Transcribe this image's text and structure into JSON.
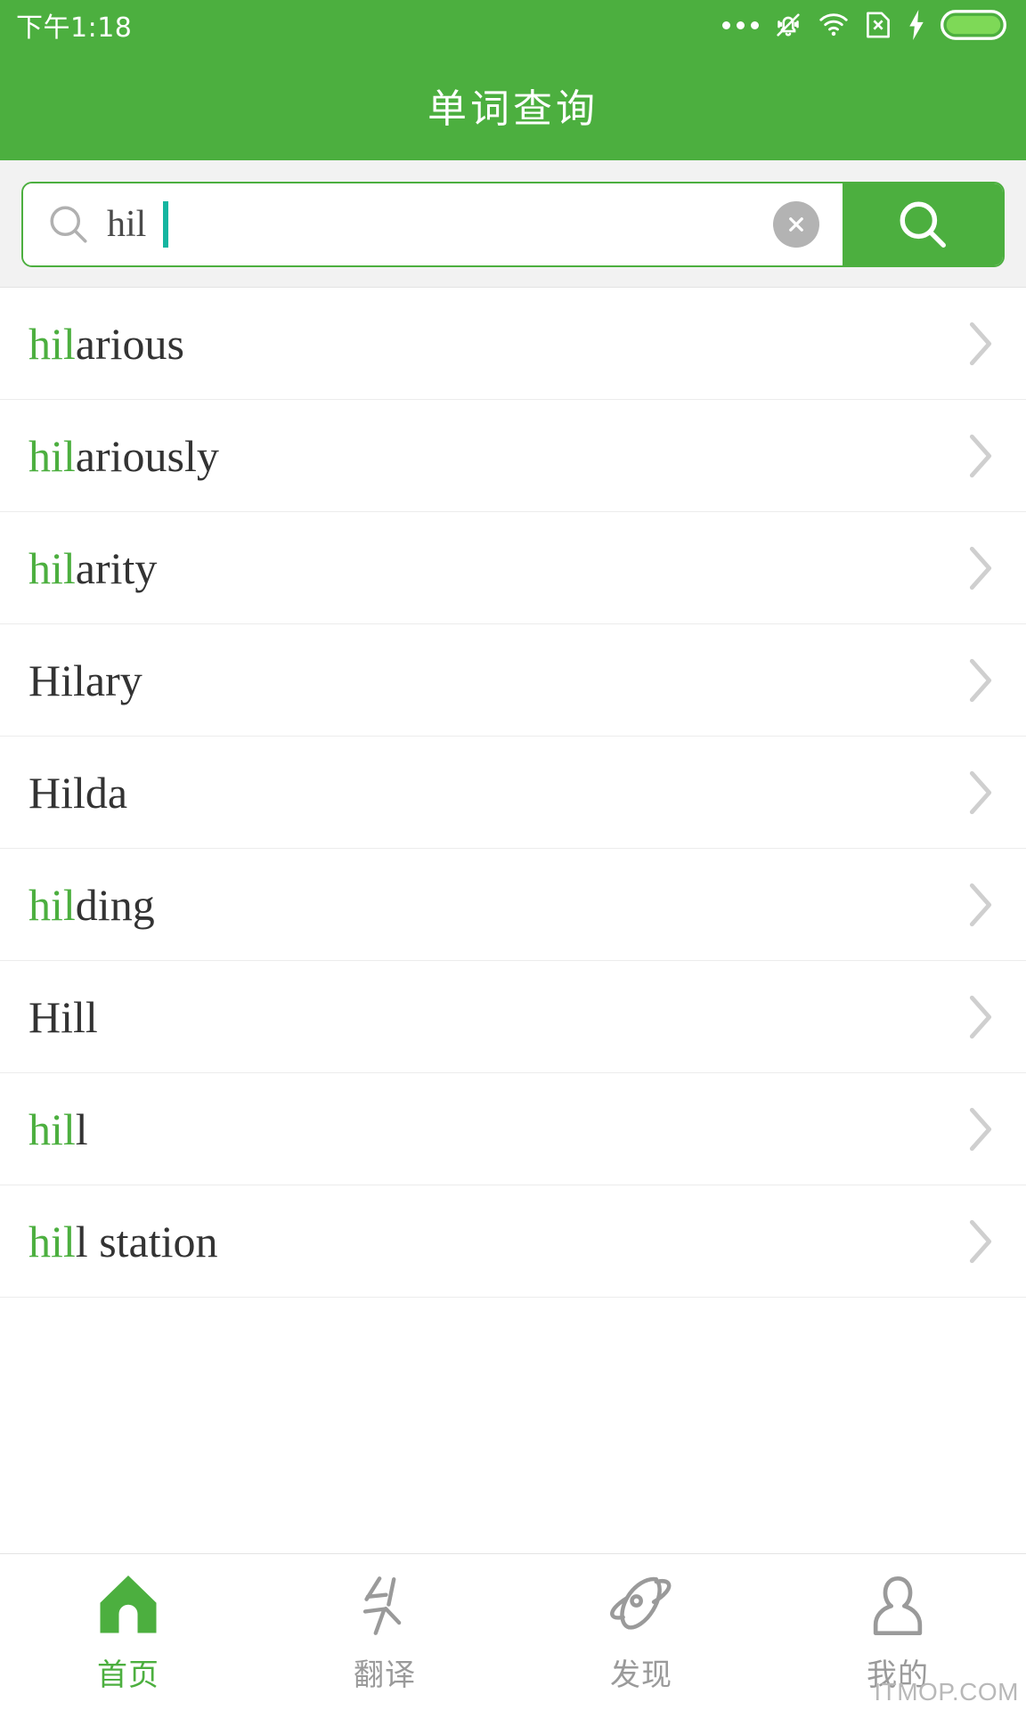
{
  "colors": {
    "brand_green": "#4caf3f",
    "caret_teal": "#15b5a0",
    "word_dark": "#333333",
    "muted_gray": "#9a9a9a"
  },
  "status_bar": {
    "time": "下午1:18",
    "icons": [
      "more-dots-icon",
      "bell-muted-icon",
      "wifi-icon",
      "sim-card-x-icon",
      "charging-bolt-icon",
      "battery-icon"
    ]
  },
  "header": {
    "title": "单词查询"
  },
  "search": {
    "value": "hil",
    "placeholder": "",
    "magnifier_icon": "search-icon",
    "clear_icon": "clear-circle-x-icon",
    "submit_icon": "search-icon"
  },
  "results": [
    {
      "prefix": "hil",
      "rest": "arious",
      "full": "hilarious"
    },
    {
      "prefix": "hil",
      "rest": "ariously",
      "full": "hilariously"
    },
    {
      "prefix": "hil",
      "rest": "arity",
      "full": "hilarity"
    },
    {
      "prefix": "",
      "rest": "Hilary",
      "full": "Hilary"
    },
    {
      "prefix": "",
      "rest": "Hilda",
      "full": "Hilda"
    },
    {
      "prefix": "hil",
      "rest": "ding",
      "full": "hilding"
    },
    {
      "prefix": "",
      "rest": "Hill",
      "full": "Hill"
    },
    {
      "prefix": "hil",
      "rest": "l",
      "full": "hill"
    },
    {
      "prefix": "hil",
      "rest": "l station",
      "full": "hill station"
    }
  ],
  "tabbar": {
    "items": [
      {
        "label": "首页",
        "icon": "home-icon",
        "active": true
      },
      {
        "label": "翻译",
        "icon": "translate-icon",
        "active": false
      },
      {
        "label": "发现",
        "icon": "rocket-icon",
        "active": false
      },
      {
        "label": "我的",
        "icon": "person-icon",
        "active": false
      }
    ]
  },
  "watermark": {
    "text": "ITMOP.COM"
  }
}
